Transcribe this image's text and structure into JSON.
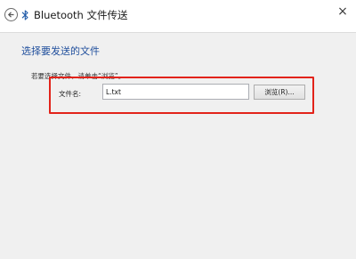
{
  "window": {
    "title": "Bluetooth 文件传送",
    "close_glyph": "×",
    "back_icon": "back-arrow-icon",
    "app_icon": "bluetooth-icon"
  },
  "main": {
    "heading": "选择要发送的文件",
    "hint": "若要选择文件，请单击“浏览”。",
    "filename_label": "文件名:",
    "filename_value": "L.txt",
    "browse_label": "浏览(R)..."
  },
  "colors": {
    "heading": "#1f4e9c",
    "highlight_border": "#e2231a",
    "content_bg": "#f0f0f0"
  }
}
